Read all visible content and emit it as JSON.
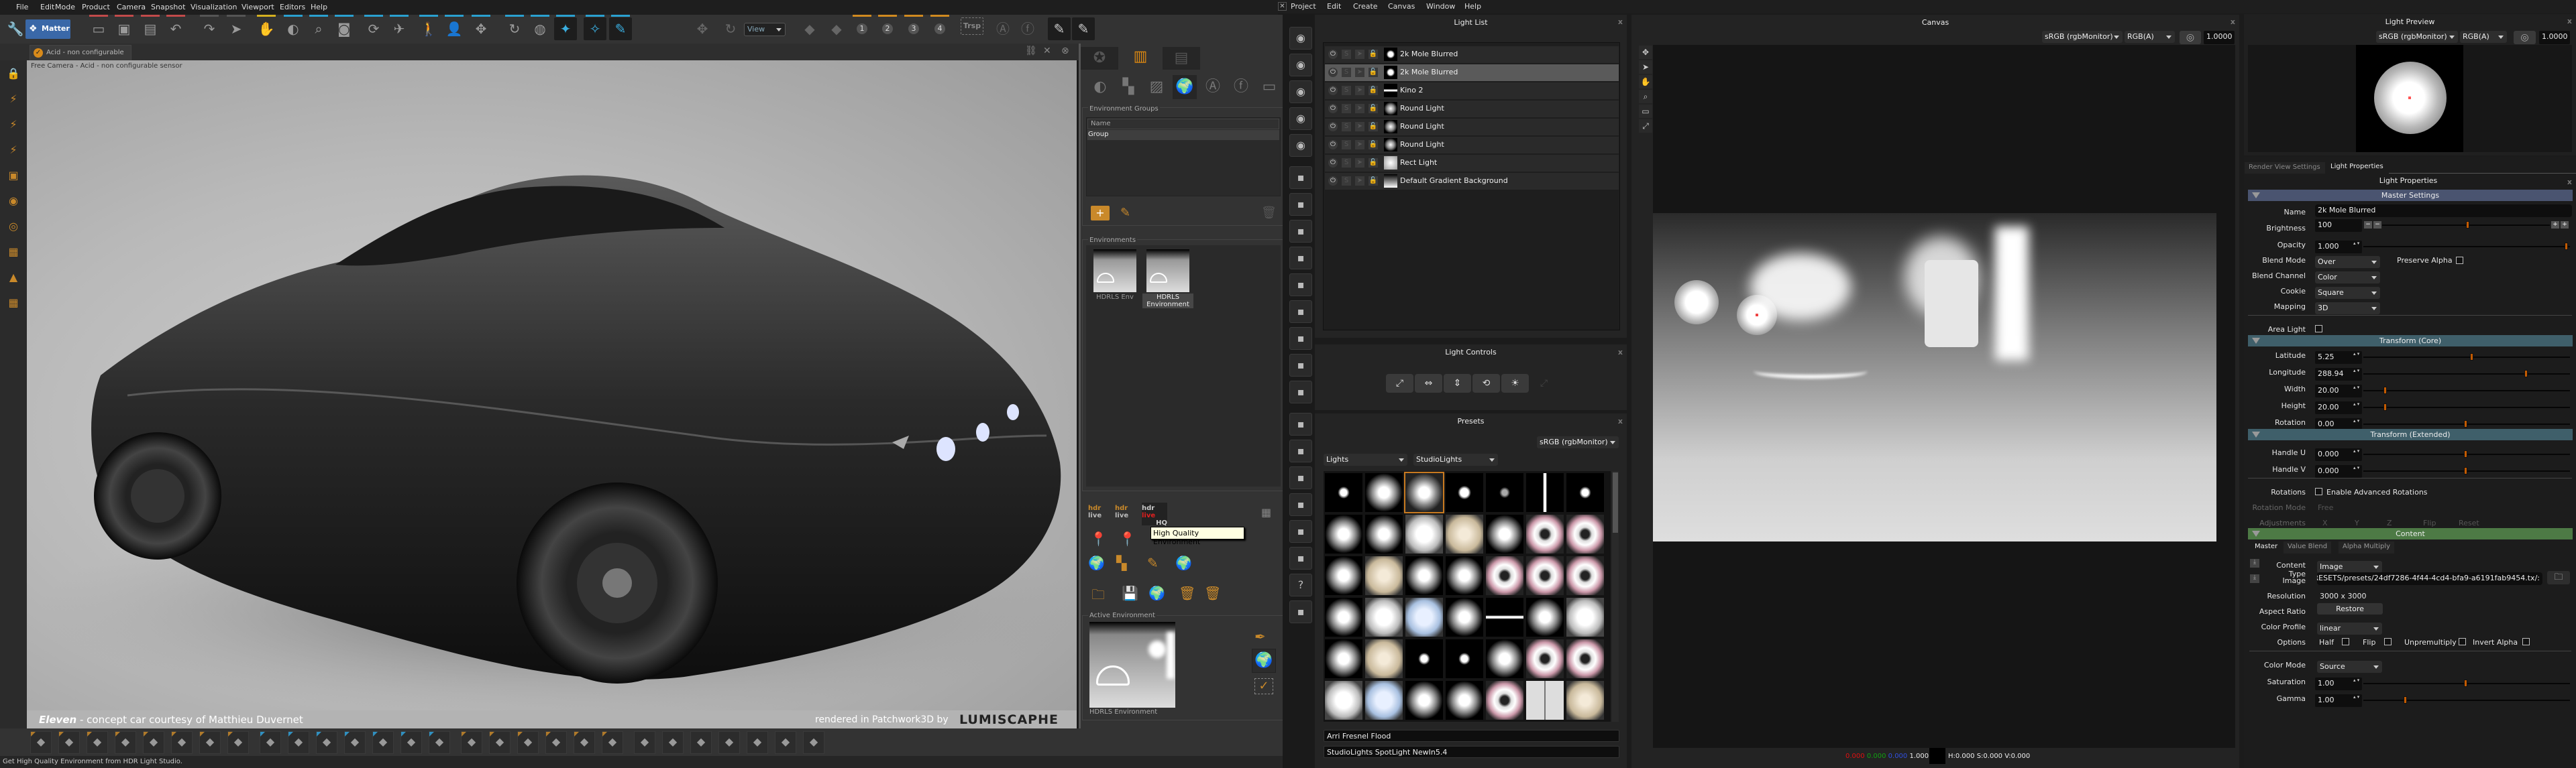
{
  "p3d": {
    "menu": [
      "File",
      "Edit",
      "Mode",
      "Product",
      "Camera",
      "Snapshot",
      "Visualization",
      "Viewport",
      "Editors",
      "Help"
    ],
    "matter_label": "Matter",
    "view_select": "View",
    "trsp_label": "Trsp",
    "camera_numbers": [
      "1",
      "2",
      "3",
      "4"
    ],
    "doc_tab": "Acid - non configurable",
    "viewport": {
      "header": "Free Camera - Acid - non configurable sensor",
      "caption_title": "Eleven",
      "caption_rest": " - concept car courtesy of Matthieu Duvernet",
      "credit": "rendered in Patchwork3D by",
      "logo": "LUMISCAPHE",
      "watermark": "LUMISCAPHE"
    },
    "toolbar_icons": [
      "wrench",
      "new-document",
      "open-folder",
      "save",
      "save-as",
      "undo",
      "redo",
      "select-arrow",
      "hand",
      "orbit",
      "zoom",
      "camera-snapshot",
      "camera-rotate",
      "fly",
      "walk",
      "person",
      "move",
      "rotate-view",
      "globe-rotate",
      "touch-select",
      "touch-multi",
      "paint-tool"
    ],
    "right_toolbar_icons": [
      "move-disabled",
      "rotate-disabled",
      "prev-view",
      "next-view",
      "camera-1",
      "camera-2",
      "camera-3",
      "camera-4",
      "transparency",
      "aa-badge",
      "fx-badge",
      "brush-check",
      "brush"
    ],
    "side_icons": [
      "lock-icon",
      "bolt",
      "bolt-add",
      "bolt-list",
      "photo",
      "eye",
      "eye-target",
      "image",
      "image-mountain",
      "image-grid"
    ],
    "bottom_icons": [
      "render",
      "snapshot",
      "snapshot-settings",
      "camera-video",
      "light",
      "clapper",
      "joystick",
      "plus-list",
      "sphere-list",
      "pin",
      "globe-list",
      "spheres",
      "check-list",
      "wrench-list",
      "list",
      "disc",
      "image-edit",
      "globe",
      "aa",
      "fx",
      "film",
      "ruler",
      "pen",
      "binoculars",
      "diamond",
      "ring",
      "target",
      "axes"
    ],
    "library": {
      "env_groups_label": "Environment Groups",
      "name_column": "Name",
      "groups": [
        "Group"
      ],
      "environments_label": "Environments",
      "environments": [
        {
          "name": "HDRLS Env",
          "selected": false
        },
        {
          "name": "HDRLS Environment",
          "selected": true
        }
      ],
      "hdr_text": "hdr",
      "live_text": "live",
      "hq_text": "HQ",
      "tooltip": "High Quality Environment",
      "active_env_label": "Active Environment",
      "active_env_name": "HDRLS Environment"
    },
    "status": "Get High Quality Environment from HDR Light Studio."
  },
  "hdrls": {
    "menu": [
      "Project",
      "Edit",
      "Create",
      "Canvas",
      "Window",
      "Help"
    ],
    "light_list": {
      "title": "Light List",
      "lights": [
        {
          "name": "2k Mole Blurred",
          "thumb": "dot",
          "selected": false
        },
        {
          "name": "2k Mole Blurred",
          "thumb": "dot",
          "selected": true
        },
        {
          "name": "Kino 2",
          "thumb": "bar",
          "selected": false
        },
        {
          "name": "Round Light",
          "thumb": "round",
          "selected": false
        },
        {
          "name": "Round Light",
          "thumb": "round",
          "selected": false
        },
        {
          "name": "Round Light",
          "thumb": "round",
          "selected": false
        },
        {
          "name": "Rect Light",
          "thumb": "rect",
          "selected": false
        },
        {
          "name": "Default Gradient Background",
          "thumb": "gradient",
          "selected": false
        }
      ]
    },
    "light_controls": {
      "title": "Light Controls",
      "buttons": [
        "scale",
        "width",
        "height",
        "rotate",
        "brightness",
        "move-disabled"
      ]
    },
    "presets": {
      "title": "Presets",
      "color_profile": "sRGB (rgbMonitor)",
      "category": "Lights",
      "library": "StudioLights",
      "selected_name": "Arri Fresnel Flood",
      "selected_path": "StudioLights SpotLight NewIn5.4"
    },
    "canvas": {
      "title": "Canvas",
      "color_profile": "sRGB (rgbMonitor)",
      "channel": "RGB(A)",
      "exposure": "1.0000",
      "readout": {
        "r": "0.000",
        "g": "0.000",
        "b": "0.000",
        "a": "1.000",
        "hsv": "H:0.000 S:0.000 V:0.000"
      },
      "colors": {
        "r": "#e01010",
        "g": "#10a010",
        "b": "#3050e0"
      }
    },
    "light_preview": {
      "title": "Light Preview",
      "color_profile": "sRGB (rgbMonitor)",
      "channel": "RGB(A)",
      "exposure": "1.0000"
    },
    "properties": {
      "tabs": [
        "Render View Settings",
        "Light Properties"
      ],
      "active_tab": 1,
      "title": "Light Properties",
      "master": {
        "header": "Master Settings",
        "name_label": "Name",
        "name": "2k Mole Blurred",
        "brightness_label": "Brightness",
        "brightness": "100",
        "brightness_level": 0.5,
        "opacity_label": "Opacity",
        "opacity": "1.000",
        "opacity_level": 1.0,
        "blend_mode_label": "Blend Mode",
        "blend_mode": "Over",
        "preserve_alpha_label": "Preserve Alpha",
        "blend_channel_label": "Blend Channel",
        "blend_channel": "Color",
        "cookie_label": "Cookie",
        "cookie": "Square",
        "mapping_label": "Mapping",
        "mapping": "3D",
        "area_light_label": "Area Light"
      },
      "transform_core": {
        "header": "Transform (Core)",
        "latitude_label": "Latitude",
        "latitude": "5.25",
        "latitude_level": 0.53,
        "longitude_label": "Longitude",
        "longitude": "288.94",
        "longitude_level": 0.8,
        "width_label": "Width",
        "width": "20.00",
        "width_level": 0.1,
        "height_label": "Height",
        "height": "20.00",
        "height_level": 0.1,
        "rotation_label": "Rotation",
        "rotation": "0.00",
        "rotation_level": 0.5
      },
      "transform_extended": {
        "header": "Transform (Extended)",
        "handle_u_label": "Handle U",
        "handle_u": "0.000",
        "handle_u_level": 0.5,
        "handle_v_label": "Handle V",
        "handle_v": "0.000",
        "handle_v_level": 0.5,
        "rotations_label": "Rotations",
        "advanced_label": "Enable Advanced Rotations",
        "rotation_mode_label": "Rotation Mode",
        "rotation_mode": "Free",
        "adjustments_label": "Adjustments",
        "adj_x": "X",
        "adj_y": "Y",
        "adj_z": "Z",
        "flip": "Flip",
        "reset": "Reset"
      },
      "content": {
        "header": "Content",
        "tabs": [
          "Master",
          "Value Blend",
          "Alpha Multiply"
        ],
        "content_type_label": "Content Type",
        "content_type": "Image",
        "image_label": "Image",
        "image": ":/LIVE_PRESETS/presets/24df7286-4f44-4cd4-bfa9-a6191fab9454.tx",
        "resolution_label": "Resolution",
        "resolution": "3000 x 3000",
        "aspect_label": "Aspect Ratio",
        "restore": "Restore",
        "color_profile_label": "Color Profile",
        "color_profile": "linear",
        "options_label": "Options",
        "half": "Half",
        "flip": "Flip",
        "unpremultiply": "Unpremultiply",
        "invert_alpha": "Invert Alpha",
        "color_mode_label": "Color Mode",
        "color_mode": "Source",
        "saturation_label": "Saturation",
        "saturation": "1.00",
        "saturation_level": 0.5,
        "gamma_label": "Gamma",
        "gamma": "1.00",
        "gamma_level": 0.2
      },
      "section_colors": {
        "master": "#4a5470",
        "transform": "#3f5f6a",
        "content": "#4d7a45"
      },
      "accent": "#c35a00"
    }
  }
}
